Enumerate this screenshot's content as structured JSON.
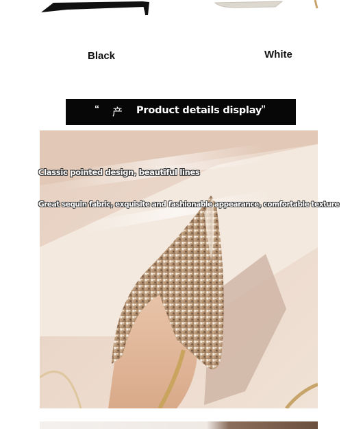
{
  "variants": [
    {
      "label": "Black"
    },
    {
      "label": "White"
    }
  ],
  "banner": {
    "open_quote": "“",
    "cn_char": "产",
    "title": "Product details display",
    "close_quote": "”"
  },
  "hero": {
    "caption_1": "Classic pointed design, beautiful lines",
    "caption_2": "Great sequin fabric, exquisite and fashionable appearance, comfortable texture"
  },
  "colors": {
    "banner_bg": "#070707",
    "photo_bg": "#e9d9cc"
  }
}
